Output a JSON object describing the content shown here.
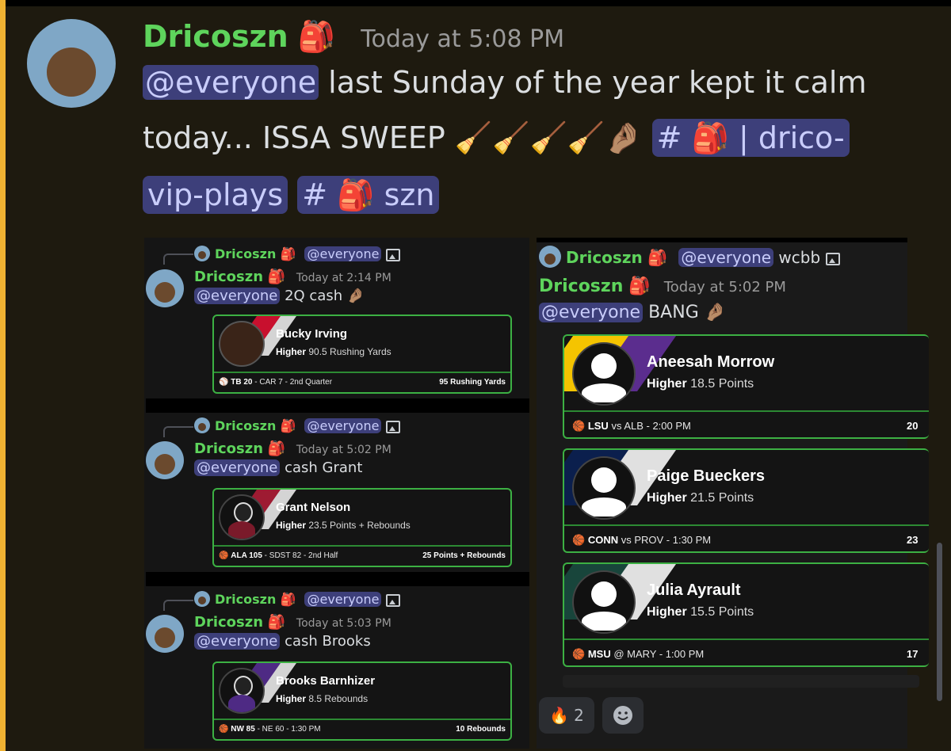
{
  "main": {
    "author": "Dricoszn",
    "author_emoji": "🎒",
    "timestamp": "Today at 5:08 PM",
    "mention": "@everyone",
    "text_line1": "last Sunday of the year kept it calm",
    "text_line2": "today... ISSA SWEEP",
    "text_emojis": "🧹🧹🧹🧹🤌🏽",
    "channel1_hash": "#",
    "channel1_emoji": "🎒",
    "channel1_a": "| drico-",
    "channel1_b": "vip-plays",
    "channel2_hash": "#",
    "channel2_emoji": "🎒",
    "channel2_name": "szn"
  },
  "left_posts": [
    {
      "reply_author": "Dricoszn",
      "reply_mention": "@everyone",
      "author": "Dricoszn",
      "time": "Today at 2:14 PM",
      "mention": "@everyone",
      "text": "2Q cash",
      "emoji": "🤌🏽",
      "player": "Bucky Irving",
      "pick_dir": "Higher",
      "pick_line": "90.5 Rushing Yards",
      "foot_team": "TB 20",
      "foot_rest": "- CAR 7 - 2nd Quarter",
      "foot_right": "95 Rushing Yards"
    },
    {
      "reply_author": "Dricoszn",
      "reply_mention": "@everyone",
      "author": "Dricoszn",
      "time": "Today at 5:02 PM",
      "mention": "@everyone",
      "text": "cash Grant",
      "emoji": "",
      "player": "Grant Nelson",
      "pick_dir": "Higher",
      "pick_line": "23.5 Points + Rebounds",
      "foot_team": "ALA 105",
      "foot_rest": "- SDST 82 - 2nd Half",
      "foot_right": "25 Points + Rebounds"
    },
    {
      "reply_author": "Dricoszn",
      "reply_mention": "@everyone",
      "author": "Dricoszn",
      "time": "Today at 5:03 PM",
      "mention": "@everyone",
      "text": "cash Brooks",
      "emoji": "",
      "player": "Brooks Barnhizer",
      "pick_dir": "Higher",
      "pick_line": "8.5 Rebounds",
      "foot_team": "NW 85",
      "foot_rest": "- NE 60 - 1:30 PM",
      "foot_right": "10 Rebounds"
    }
  ],
  "right_post": {
    "reply_author": "Dricoszn",
    "reply_mention": "@everyone",
    "reply_text": "wcbb",
    "author": "Dricoszn",
    "time": "Today at 5:02 PM",
    "mention": "@everyone",
    "text": "BANG",
    "emoji": "🤌🏽",
    "cards": [
      {
        "player": "Aneesah Morrow",
        "pick_dir": "Higher",
        "pick_line": "18.5 Points",
        "foot_team": "LSU",
        "foot_rest": "vs ALB - 2:00 PM",
        "foot_right": "20"
      },
      {
        "player": "Paige Bueckers",
        "pick_dir": "Higher",
        "pick_line": "21.5 Points",
        "foot_team": "CONN",
        "foot_rest": "vs PROV - 1:30 PM",
        "foot_right": "23"
      },
      {
        "player": "Julia Ayrault",
        "pick_dir": "Higher",
        "pick_line": "15.5 Points",
        "foot_team": "MSU",
        "foot_rest": "@ MARY - 1:00 PM",
        "foot_right": "17"
      }
    ]
  },
  "reactions": [
    {
      "emoji": "🔥",
      "count": "2"
    }
  ],
  "colors": {
    "accent_bar": "#f0b232",
    "name_green": "#5ed45c",
    "mention_bg": "#3d3f7a",
    "card_border": "#3cb043"
  }
}
